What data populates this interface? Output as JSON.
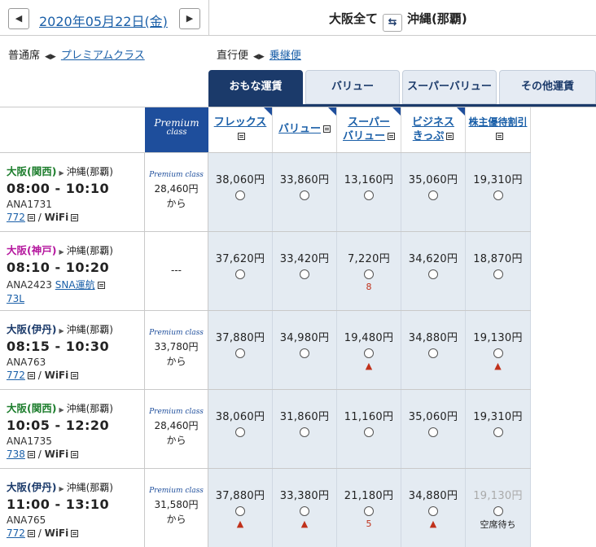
{
  "header": {
    "prev_label": "◀",
    "next_label": "▶",
    "date": "2020年05月22日(金)",
    "origin": "大阪全て",
    "swap_label": "⇆",
    "destination": "沖縄(那覇)"
  },
  "options": {
    "cabin_current": "普通席",
    "cabin_switch_arrows": "◀▶",
    "cabin_alt": "プレミアムクラス",
    "route_current": "直行便",
    "route_switch_arrows": "◀▶",
    "route_alt": "乗継便"
  },
  "tabs": [
    {
      "label": "おもな運賃",
      "active": true
    },
    {
      "label": "バリュー",
      "active": false
    },
    {
      "label": "スーパーバリュー",
      "active": false
    },
    {
      "label": "その他運賃",
      "active": false
    }
  ],
  "fare_headers": {
    "premium_line1": "Premium",
    "premium_line2": "class",
    "cols": [
      {
        "line1": "フレックス",
        "line2": ""
      },
      {
        "line1": "バリュー",
        "line2": ""
      },
      {
        "line1": "スーパー",
        "line2": "バリュー"
      },
      {
        "line1": "ビジネス",
        "line2": "きっぷ"
      },
      {
        "line1": "株主優待割引",
        "line2": ""
      }
    ]
  },
  "flights": [
    {
      "origin": "大阪(関西)",
      "origin_color": "#1c7d2c",
      "dest": "沖縄(那覇)",
      "time": "08:00 - 10:10",
      "flight_no": "ANA1731",
      "extra": "",
      "aircraft": "772",
      "wifi": "WiFi",
      "premium_label": "Premium class",
      "premium_price": "28,460円",
      "premium_suffix": "から",
      "premium_dash": "",
      "fares": [
        {
          "price": "38,060円",
          "note": ""
        },
        {
          "price": "33,860円",
          "note": ""
        },
        {
          "price": "13,160円",
          "note": ""
        },
        {
          "price": "35,060円",
          "note": ""
        },
        {
          "price": "19,310円",
          "note": ""
        }
      ]
    },
    {
      "origin": "大阪(神戸)",
      "origin_color": "#b5179e",
      "dest": "沖縄(那覇)",
      "time": "08:10 - 10:20",
      "flight_no": "ANA2423",
      "extra": "SNA運航",
      "aircraft": "73L",
      "wifi": "",
      "premium_label": "",
      "premium_price": "",
      "premium_suffix": "",
      "premium_dash": "---",
      "fares": [
        {
          "price": "37,620円",
          "note": ""
        },
        {
          "price": "33,420円",
          "note": ""
        },
        {
          "price": "7,220円",
          "note": "8"
        },
        {
          "price": "34,620円",
          "note": ""
        },
        {
          "price": "18,870円",
          "note": ""
        }
      ]
    },
    {
      "origin": "大阪(伊丹)",
      "origin_color": "#1b3a6a",
      "dest": "沖縄(那覇)",
      "time": "08:15 - 10:30",
      "flight_no": "ANA763",
      "extra": "",
      "aircraft": "772",
      "wifi": "WiFi",
      "premium_label": "Premium class",
      "premium_price": "33,780円",
      "premium_suffix": "から",
      "premium_dash": "",
      "fares": [
        {
          "price": "37,880円",
          "note": ""
        },
        {
          "price": "34,980円",
          "note": ""
        },
        {
          "price": "19,480円",
          "note": "▲"
        },
        {
          "price": "34,880円",
          "note": ""
        },
        {
          "price": "19,130円",
          "note": "▲"
        }
      ]
    },
    {
      "origin": "大阪(関西)",
      "origin_color": "#1c7d2c",
      "dest": "沖縄(那覇)",
      "time": "10:05 - 12:20",
      "flight_no": "ANA1735",
      "extra": "",
      "aircraft": "738",
      "wifi": "WiFi",
      "premium_label": "Premium class",
      "premium_price": "28,460円",
      "premium_suffix": "から",
      "premium_dash": "",
      "fares": [
        {
          "price": "38,060円",
          "note": ""
        },
        {
          "price": "31,860円",
          "note": ""
        },
        {
          "price": "11,160円",
          "note": ""
        },
        {
          "price": "35,060円",
          "note": ""
        },
        {
          "price": "19,310円",
          "note": ""
        }
      ]
    },
    {
      "origin": "大阪(伊丹)",
      "origin_color": "#1b3a6a",
      "dest": "沖縄(那覇)",
      "time": "11:00 - 13:10",
      "flight_no": "ANA765",
      "extra": "",
      "aircraft": "772",
      "wifi": "WiFi",
      "premium_label": "Premium class",
      "premium_price": "31,580円",
      "premium_suffix": "から",
      "premium_dash": "",
      "fares": [
        {
          "price": "37,880円",
          "note": "▲"
        },
        {
          "price": "33,380円",
          "note": "▲"
        },
        {
          "price": "21,180円",
          "note": "5"
        },
        {
          "price": "34,880円",
          "note": "▲"
        },
        {
          "price": "19,130円",
          "note": "空席待ち",
          "gray": true
        }
      ]
    }
  ]
}
